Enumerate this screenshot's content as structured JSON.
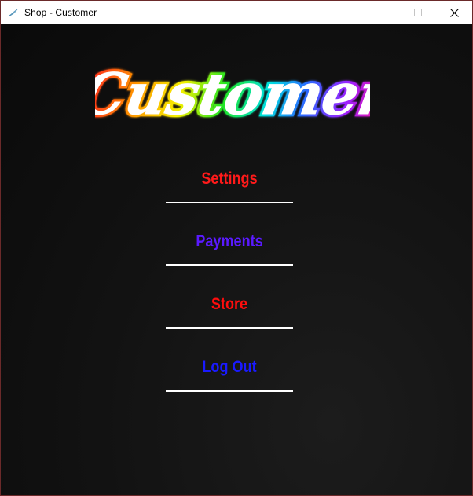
{
  "window": {
    "title": "Shop - Customer"
  },
  "logo": {
    "text": "Customer"
  },
  "menu": {
    "settings": {
      "label": "Settings",
      "color": "#ff1a1a"
    },
    "payments": {
      "label": "Payments",
      "color": "#5a1aff"
    },
    "store": {
      "label": "Store",
      "color": "#ff0d0d"
    },
    "logout": {
      "label": "Log Out",
      "color": "#1a1aff"
    }
  },
  "colors": {
    "titlebar": "#ffffff",
    "background": "#111111",
    "underline": "#ffffff"
  },
  "icons": {
    "app": "feather-icon",
    "minimize": "minimize-icon",
    "maximize": "maximize-icon",
    "close": "close-icon"
  }
}
